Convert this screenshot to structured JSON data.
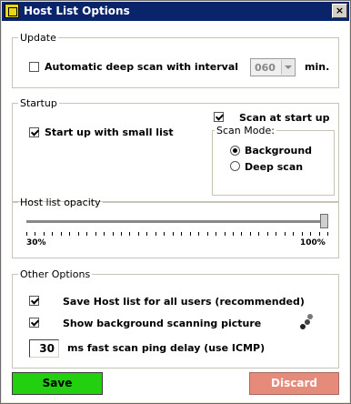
{
  "window": {
    "title": "Host List Options",
    "close_glyph": "×"
  },
  "update": {
    "legend": "Update",
    "auto_deep_scan": {
      "label": "Automatic deep scan with interval",
      "checked": false
    },
    "interval": {
      "value": "060",
      "unit": "min."
    }
  },
  "startup": {
    "legend": "Startup",
    "small_list": {
      "label": "Start up with small list",
      "checked": true
    },
    "scan_at_startup": {
      "label": "Scan at start up",
      "checked": true
    },
    "scan_mode": {
      "legend": "Scan Mode:",
      "options": [
        {
          "label": "Background",
          "selected": true
        },
        {
          "label": "Deep scan",
          "selected": false
        }
      ]
    }
  },
  "opacity": {
    "legend": "Host list opacity",
    "min_label": "30%",
    "max_label": "100%",
    "value_percent": 100
  },
  "other": {
    "legend": "Other Options",
    "save_all_users": {
      "label": "Save Host list for all users (recommended)",
      "checked": true
    },
    "show_picture": {
      "label": "Show background scanning picture",
      "checked": true
    },
    "ping_delay": {
      "value": "30",
      "label": "ms fast scan ping delay (use ICMP)"
    }
  },
  "buttons": {
    "save": "Save",
    "discard": "Discard"
  },
  "colors": {
    "title_bar": "#0a246a",
    "save": "#22d010",
    "discard": "#e68a7a"
  }
}
